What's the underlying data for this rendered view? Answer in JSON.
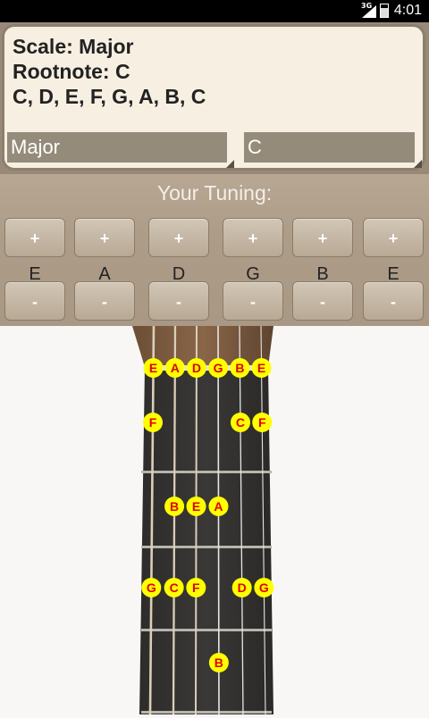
{
  "status_bar": {
    "time": "4:01",
    "network": "3G"
  },
  "info": {
    "scale_line": "Scale: Major",
    "root_line": "Rootnote: C",
    "notes_line": "C, D, E, F, G, A, B, C"
  },
  "scale_select": {
    "value": "Major"
  },
  "root_select": {
    "value": "C"
  },
  "tuning": {
    "title": "Your Tuning:",
    "plus_label": "+",
    "minus_label": "-",
    "strings": [
      "E",
      "A",
      "D",
      "G",
      "B",
      "E"
    ]
  },
  "fretboard": {
    "dot_color": "#ffff00",
    "dot_text_color": "#e00000",
    "markers": [
      {
        "label": "E",
        "string": 1,
        "fret": 0
      },
      {
        "label": "A",
        "string": 2,
        "fret": 0
      },
      {
        "label": "D",
        "string": 3,
        "fret": 0
      },
      {
        "label": "G",
        "string": 4,
        "fret": 0
      },
      {
        "label": "B",
        "string": 5,
        "fret": 0
      },
      {
        "label": "E",
        "string": 6,
        "fret": 0
      },
      {
        "label": "F",
        "string": 1,
        "fret": 1
      },
      {
        "label": "C",
        "string": 5,
        "fret": 1
      },
      {
        "label": "F",
        "string": 6,
        "fret": 1
      },
      {
        "label": "B",
        "string": 2,
        "fret": 2
      },
      {
        "label": "E",
        "string": 3,
        "fret": 2
      },
      {
        "label": "A",
        "string": 4,
        "fret": 2
      },
      {
        "label": "G",
        "string": 1,
        "fret": 3
      },
      {
        "label": "C",
        "string": 2,
        "fret": 3
      },
      {
        "label": "F",
        "string": 3,
        "fret": 3
      },
      {
        "label": "D",
        "string": 5,
        "fret": 3
      },
      {
        "label": "G",
        "string": 6,
        "fret": 3
      },
      {
        "label": "B",
        "string": 4,
        "fret": 4
      }
    ]
  }
}
